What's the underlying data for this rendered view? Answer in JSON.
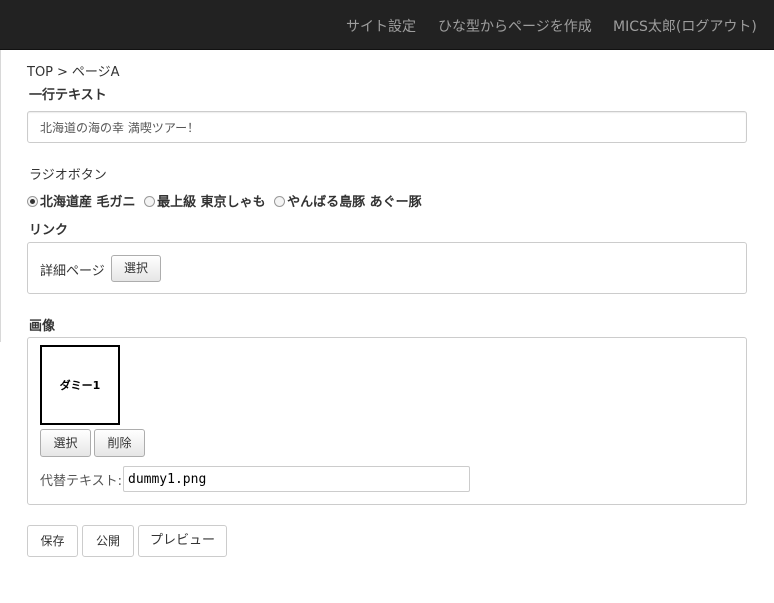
{
  "nav": {
    "items": [
      {
        "label": "サイト設定"
      },
      {
        "label": "ひな型からページを作成"
      },
      {
        "label": "MICS太郎(ログアウト)"
      }
    ]
  },
  "breadcrumb": {
    "home": "TOP",
    "separator": ">",
    "current": "ページA"
  },
  "form": {
    "text_field": {
      "label": "一行テキスト",
      "value": "北海道の海の幸 満喫ツアー！"
    },
    "radio": {
      "label": "ラジオボタン",
      "selected": "北海道産 毛ガニ",
      "options": [
        {
          "label": "北海道産 毛ガニ",
          "checked": true
        },
        {
          "label": "最上級 東京しゃも",
          "checked": false
        },
        {
          "label": "やんばる島豚 あぐー豚",
          "checked": false
        }
      ]
    },
    "link": {
      "label": "リンク",
      "text": "詳細ページ",
      "select_button": "選択"
    },
    "image": {
      "label": "画像",
      "placeholder_text": "ダミー1",
      "select_button": "選択",
      "delete_button": "削除",
      "alt_label": "代替テキスト:",
      "alt_value": "dummy1.png"
    }
  },
  "actions": {
    "save": "保存",
    "publish": "公開",
    "preview": "プレビュー"
  },
  "colors": {
    "navbar_bg": "#222222",
    "navbar_text": "#9d9d9d",
    "border": "#cccccc"
  }
}
